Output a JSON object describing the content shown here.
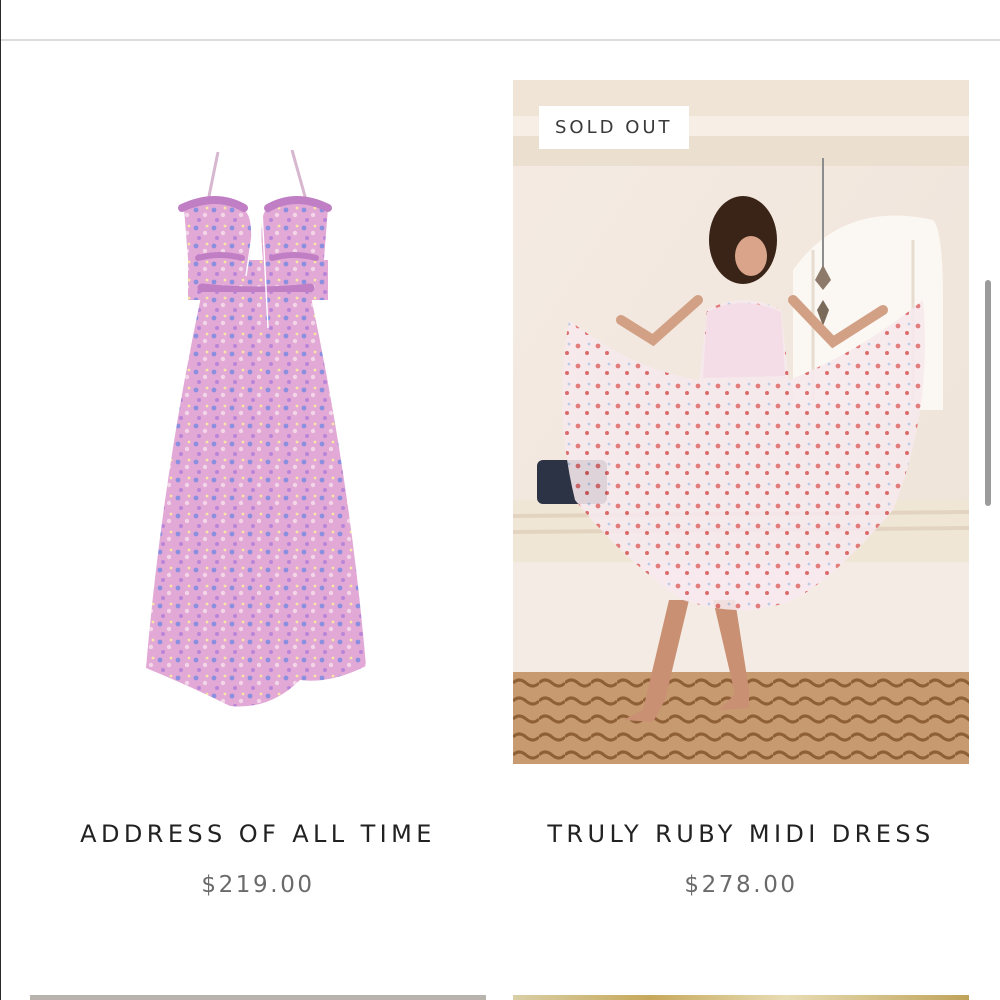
{
  "products": [
    {
      "title": "ADDRESS OF ALL TIME",
      "price": "$219.00",
      "image": "pink-floral-halter-maxi-dress"
    },
    {
      "title": "TRULY RUBY MIDI DRESS",
      "price": "$278.00",
      "badge": "SOLD OUT",
      "image": "model-in-floral-sheer-midi-dress"
    }
  ],
  "colors": {
    "title_text": "#222222",
    "price_text": "#6a6a6a",
    "badge_bg": "#ffffff",
    "badge_text": "#3a3a3a",
    "divider": "#dcdcdc",
    "scrollbar": "#9b9b9b"
  }
}
